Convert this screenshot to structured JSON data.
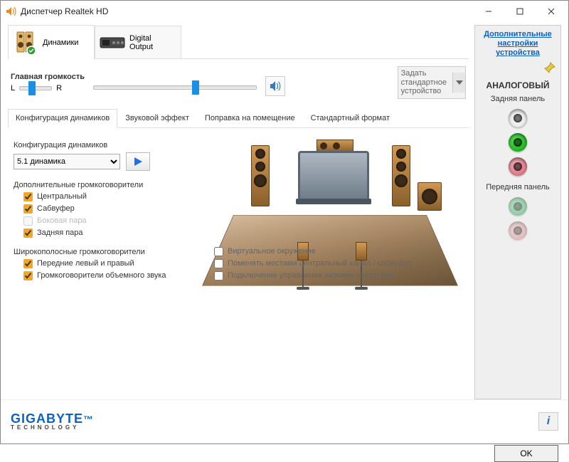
{
  "window": {
    "title": "Диспетчер Realtek HD"
  },
  "devices": {
    "tab1": "Динамики",
    "tab2": "Digital Output"
  },
  "volume": {
    "label": "Главная громкость",
    "left": "L",
    "right": "R"
  },
  "defaultDevice": {
    "set": "Задать",
    "standard": "стандартное",
    "device": "устройство"
  },
  "subtabs": {
    "config": "Конфигурация динамиков",
    "effect": "Звуковой эффект",
    "room": "Поправка на помещение",
    "format": "Стандартный формат"
  },
  "config": {
    "heading": "Конфигурация динамиков",
    "selected": "5.1 динамика",
    "optional_heading": "Дополнительные громкоговорители",
    "center": "Центральный",
    "sub": "Сабвуфер",
    "side": "Боковая пара",
    "rear": "Задняя пара",
    "fullrange_heading": "Широкополосные громкоговорители",
    "front_lr": "Передние левый и правый",
    "surround": "Громкоговорители объемного звука"
  },
  "scene_opts": {
    "virtual": "Виртуальное окружение",
    "swap": "Поменять местами центральный канал / сабвуфер",
    "bass": "Подключение управления низкими частотами"
  },
  "right": {
    "adv_link": "Дополнительные настройки устройства",
    "analog": "АНАЛОГОВЫЙ",
    "rear_panel": "Задняя панель",
    "front_panel": "Передняя панель",
    "jack_colors": {
      "rear1": "#1141c8",
      "rear2": "#14a514",
      "rear3": "#d66b7b",
      "front1": "#3e9e5e",
      "front2": "#cc8b8b"
    }
  },
  "footer": {
    "brand": "GIGABYTE",
    "tech": "TECHNOLOGY",
    "ok": "OK"
  }
}
